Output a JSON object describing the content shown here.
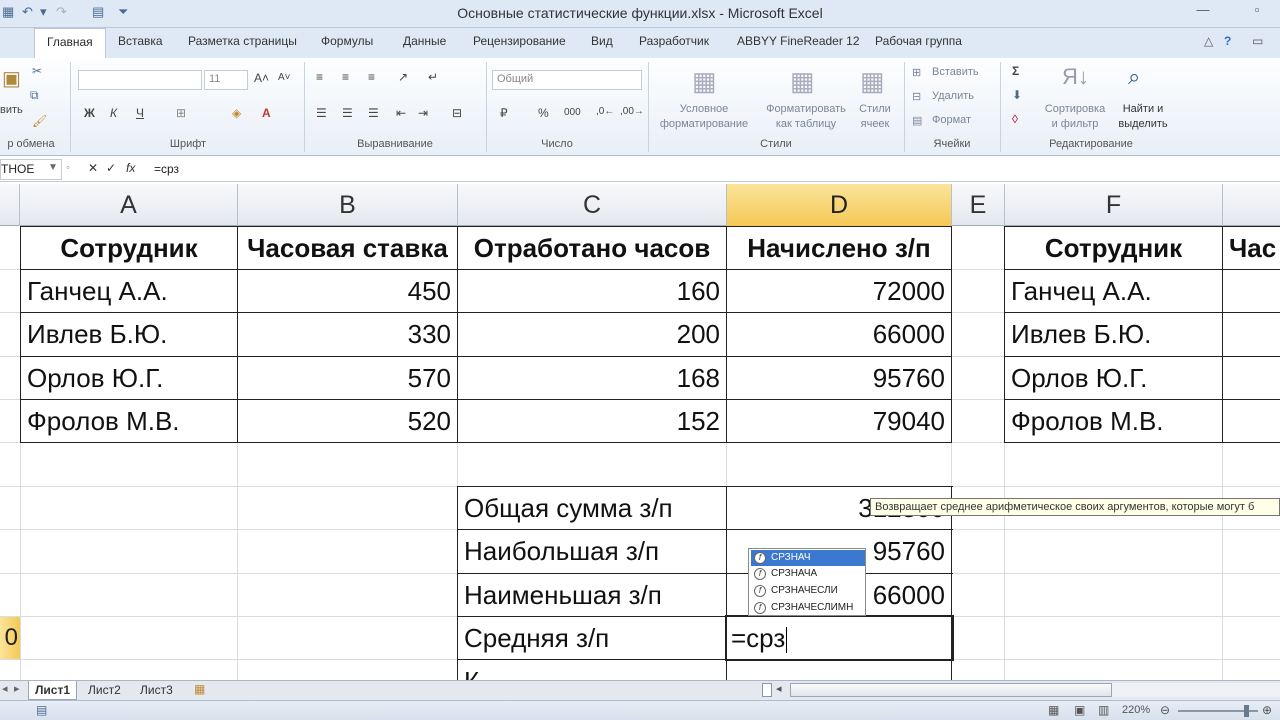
{
  "window": {
    "title": "Основные статистические функции.xlsx - Microsoft Excel"
  },
  "ribbon_tabs": [
    "Главная",
    "Вставка",
    "Разметка страницы",
    "Формулы",
    "Данные",
    "Рецензирование",
    "Вид",
    "Разработчик",
    "ABBYY FineReader 12",
    "Рабочая группа"
  ],
  "file_tab": "йл",
  "ribbon": {
    "clipboard": {
      "paste_label": "вить",
      "group": "р обмена"
    },
    "font": {
      "size": "11",
      "group": "Шрифт",
      "bold": "Ж",
      "italic": "К",
      "underline": "Ч"
    },
    "alignment": {
      "group": "Выравнивание"
    },
    "number": {
      "format": "Общий",
      "group": "Число",
      "percent": "%",
      "thousands": "000"
    },
    "styles": {
      "cond_format": "Условное\nформатирование",
      "format_table": "Форматировать\nкак таблицу",
      "cell_styles": "Стили\nячеек",
      "group": "Стили"
    },
    "cells": {
      "insert": "Вставить",
      "delete": "Удалить",
      "format": "Формат",
      "group": "Ячейки"
    },
    "editing": {
      "sort": "Сортировка\nи фильтр",
      "find": "Найти и\nвыделить",
      "group": "Редактирование",
      "sigma": "Σ"
    }
  },
  "formula_bar": {
    "name_box": "ТНОЕ",
    "cancel": "✕",
    "enter": "✓",
    "fx": "fx",
    "value": "=срз"
  },
  "columns": [
    "A",
    "B",
    "C",
    "D",
    "E",
    "F"
  ],
  "table1": {
    "headers": [
      "Сотрудник",
      "Часовая ставка",
      "Отработано часов",
      "Начислено з/п"
    ],
    "rows": [
      [
        "Ганчец А.А.",
        "450",
        "160",
        "72000"
      ],
      [
        "Ивлев Б.Ю.",
        "330",
        "200",
        "66000"
      ],
      [
        "Орлов Ю.Г.",
        "570",
        "168",
        "95760"
      ],
      [
        "Фролов М.В.",
        "520",
        "152",
        "79040"
      ]
    ]
  },
  "table2": {
    "header": "Сотрудник",
    "header_partial": "Час",
    "rows": [
      "Ганчец А.А.",
      "Ивлев Б.Ю.",
      "Орлов Ю.Г.",
      "Фролов М.В."
    ]
  },
  "summary": {
    "rows": [
      {
        "label": "Общая сумма з/п",
        "value": "312800"
      },
      {
        "label": "Наибольшая з/п",
        "value": "95760"
      },
      {
        "label": "Наименьшая з/п",
        "value": "66000"
      },
      {
        "label": "Средняя з/п",
        "value": "=срз"
      },
      {
        "label": "К",
        "value": ""
      }
    ]
  },
  "row_number_partial": "0",
  "tooltip": "Возвращает среднее арифметическое своих аргументов, которые могут б",
  "autocomplete": [
    "СРЗНАЧ",
    "СРЗНАЧА",
    "СРЗНАЧЕСЛИ",
    "СРЗНАЧЕСЛИМН"
  ],
  "sheets": [
    "Лист1",
    "Лист2",
    "Лист3"
  ],
  "status": {
    "zoom": "220%"
  }
}
